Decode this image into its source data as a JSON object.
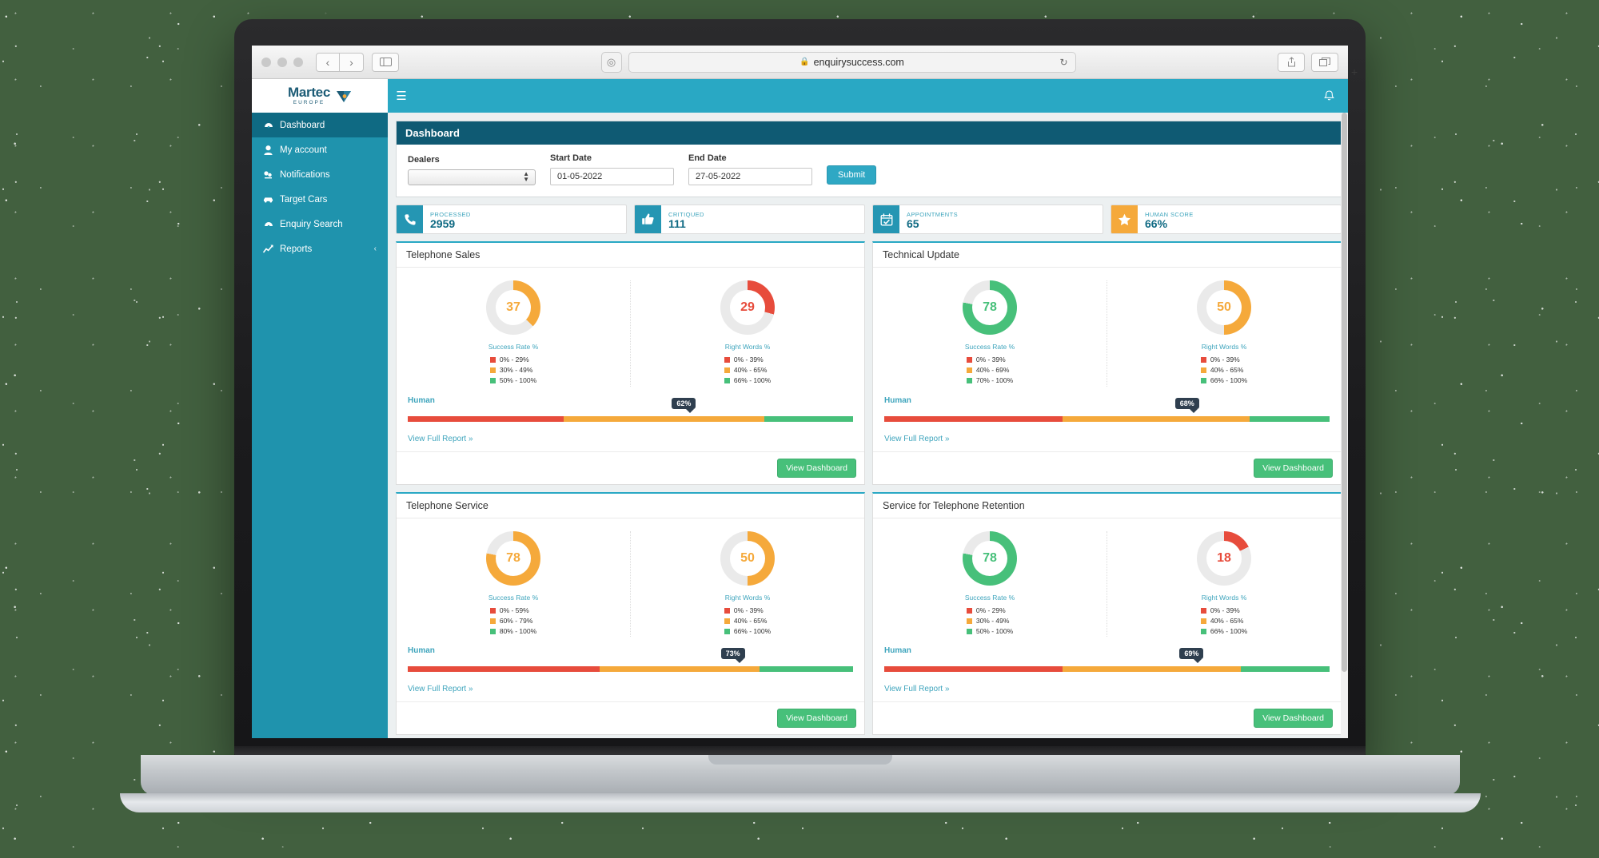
{
  "browser": {
    "url": "enquirysuccess.com",
    "lock_icon": "lock-icon",
    "reload_icon": "reload-icon",
    "back_icon": "back-arrow-icon",
    "forward_icon": "forward-arrow-icon",
    "sidebar_toggle_icon": "sidebar-toggle-icon",
    "shield_icon": "shield-icon",
    "share_icon": "share-icon",
    "tabs_icon": "tabs-icon",
    "new_tab_icon": "new-tab-icon"
  },
  "sidebar": {
    "brand": {
      "name": "Martec",
      "sub": "EUROPE"
    },
    "items": [
      {
        "label": "Dashboard",
        "icon": "dashboard-icon",
        "active": true
      },
      {
        "label": "My account",
        "icon": "user-icon",
        "active": false
      },
      {
        "label": "Notifications",
        "icon": "bell-alt-icon",
        "active": false
      },
      {
        "label": "Target Cars",
        "icon": "car-icon",
        "active": false
      },
      {
        "label": "Enquiry Search",
        "icon": "search-dashboard-icon",
        "active": false
      },
      {
        "label": "Reports",
        "icon": "chart-line-icon",
        "active": false,
        "chevron": "‹"
      }
    ]
  },
  "topbar": {
    "menu_icon": "hamburger-icon",
    "bell_icon": "bell-icon"
  },
  "filter_panel": {
    "title": "Dashboard",
    "dealers_label": "Dealers",
    "dealers_value": "",
    "dealers_placeholder": "",
    "start_label": "Start Date",
    "start_value": "01-05-2022",
    "end_label": "End Date",
    "end_value": "27-05-2022",
    "submit_label": "Submit"
  },
  "stats": [
    {
      "caption": "PROCESSED",
      "value": "2959",
      "icon": "phone-icon",
      "color": "#2596b3"
    },
    {
      "caption": "CRITIQUED",
      "value": "111",
      "icon": "thumbs-up-icon",
      "color": "#2596b3"
    },
    {
      "caption": "APPOINTMENTS",
      "value": "65",
      "icon": "calendar-check-icon",
      "color": "#2596b3"
    },
    {
      "caption": "HUMAN SCORE",
      "value": "66%",
      "icon": "star-icon",
      "color": "#f5a93b"
    }
  ],
  "colors": {
    "red": "#e74c3c",
    "orange": "#f5a93b",
    "green": "#47c07a",
    "track": "#eaeaea",
    "accent": "#29a8c4"
  },
  "common": {
    "human_label": "Human",
    "report_link": "View Full Report »",
    "view_dashboard": "View Dashboard",
    "success_label": "Success Rate %",
    "rightwords_label": "Right Words %"
  },
  "chart_data": [
    {
      "type": "pie",
      "title": "Telephone Sales",
      "gauges": [
        {
          "label": "Success Rate %",
          "value": 37,
          "color": "#f5a93b",
          "legend": [
            {
              "range": "0% - 29%",
              "color": "#e74c3c"
            },
            {
              "range": "30% - 49%",
              "color": "#f5a93b"
            },
            {
              "range": "50% - 100%",
              "color": "#47c07a"
            }
          ]
        },
        {
          "label": "Right Words %",
          "value": 29,
          "color": "#e74c3c",
          "legend": [
            {
              "range": "0% - 39%",
              "color": "#e74c3c"
            },
            {
              "range": "40% - 65%",
              "color": "#f5a93b"
            },
            {
              "range": "66% - 100%",
              "color": "#47c07a"
            }
          ]
        }
      ],
      "human": {
        "label": "Human",
        "value": 62,
        "display": "62%",
        "segments": [
          35,
          45,
          20
        ]
      }
    },
    {
      "type": "pie",
      "title": "Technical Update",
      "gauges": [
        {
          "label": "Success Rate %",
          "value": 78,
          "color": "#47c07a",
          "legend": [
            {
              "range": "0% - 39%",
              "color": "#e74c3c"
            },
            {
              "range": "40% - 69%",
              "color": "#f5a93b"
            },
            {
              "range": "70% - 100%",
              "color": "#47c07a"
            }
          ]
        },
        {
          "label": "Right Words %",
          "value": 50,
          "color": "#f5a93b",
          "legend": [
            {
              "range": "0% - 39%",
              "color": "#e74c3c"
            },
            {
              "range": "40% - 65%",
              "color": "#f5a93b"
            },
            {
              "range": "66% - 100%",
              "color": "#47c07a"
            }
          ]
        }
      ],
      "human": {
        "label": "Human",
        "value": 68,
        "display": "68%",
        "segments": [
          40,
          42,
          18
        ]
      }
    },
    {
      "type": "pie",
      "title": "Telephone Service",
      "gauges": [
        {
          "label": "Success Rate %",
          "value": 78,
          "color": "#f5a93b",
          "legend": [
            {
              "range": "0% - 59%",
              "color": "#e74c3c"
            },
            {
              "range": "60% - 79%",
              "color": "#f5a93b"
            },
            {
              "range": "80% - 100%",
              "color": "#47c07a"
            }
          ]
        },
        {
          "label": "Right Words %",
          "value": 50,
          "color": "#f5a93b",
          "legend": [
            {
              "range": "0% - 39%",
              "color": "#e74c3c"
            },
            {
              "range": "40% - 65%",
              "color": "#f5a93b"
            },
            {
              "range": "66% - 100%",
              "color": "#47c07a"
            }
          ]
        }
      ],
      "human": {
        "label": "Human",
        "value": 73,
        "display": "73%",
        "segments": [
          43,
          36,
          21
        ]
      }
    },
    {
      "type": "pie",
      "title": "Service for Telephone Retention",
      "gauges": [
        {
          "label": "Success Rate %",
          "value": 78,
          "color": "#47c07a",
          "legend": [
            {
              "range": "0% - 29%",
              "color": "#e74c3c"
            },
            {
              "range": "30% - 49%",
              "color": "#f5a93b"
            },
            {
              "range": "50% - 100%",
              "color": "#47c07a"
            }
          ]
        },
        {
          "label": "Right Words %",
          "value": 18,
          "color": "#e74c3c",
          "legend": [
            {
              "range": "0% - 39%",
              "color": "#e74c3c"
            },
            {
              "range": "40% - 65%",
              "color": "#f5a93b"
            },
            {
              "range": "66% - 100%",
              "color": "#47c07a"
            }
          ]
        }
      ],
      "human": {
        "label": "Human",
        "value": 69,
        "display": "69%",
        "segments": [
          40,
          40,
          20
        ]
      }
    }
  ]
}
